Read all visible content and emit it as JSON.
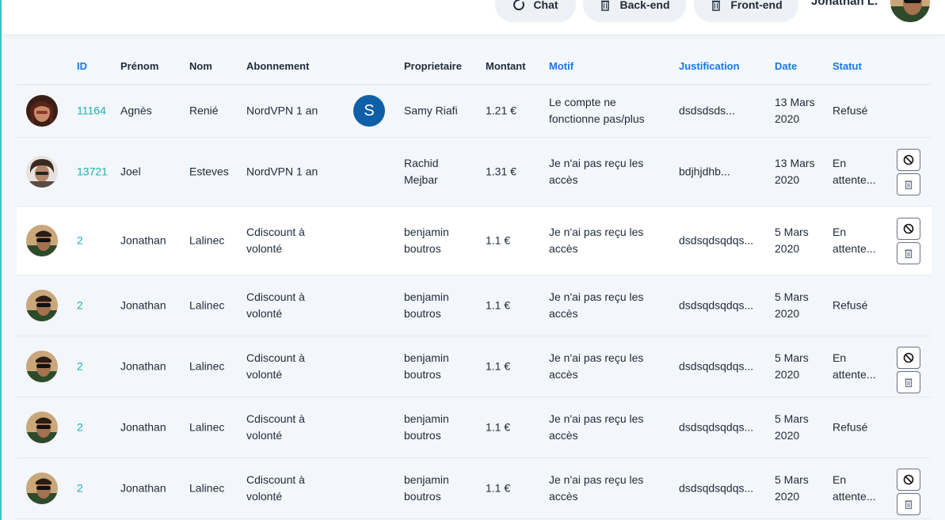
{
  "topbar": {
    "chat_label": "Chat",
    "backend_label": "Back-end",
    "frontend_label": "Front-end",
    "user_name": "Jonathan L."
  },
  "table": {
    "headers": {
      "id": "ID",
      "prenom": "Prénom",
      "nom": "Nom",
      "abonnement": "Abonnement",
      "proprietaire": "Proprietaire",
      "montant": "Montant",
      "motif": "Motif",
      "justification": "Justification",
      "date": "Date",
      "statut": "Statut"
    },
    "rows": [
      {
        "id": "11164",
        "prenom": "Agnès",
        "nom": "Renié",
        "abonnement": "NordVPN 1 an",
        "badge": "S",
        "proprietaire": "Samy Riafi",
        "montant": "1.21 €",
        "motif": "Le compte ne fonctionne pas/plus",
        "justification": "dsdsdsds...",
        "date": "13 Mars 2020",
        "statut": "Refusé"
      },
      {
        "id": "13721",
        "prenom": "Joel",
        "nom": "Esteves",
        "abonnement": "NordVPN 1 an",
        "proprietaire": "Rachid Mejbar",
        "montant": "1.31 €",
        "motif": "Je n'ai pas reçu les accès",
        "justification": "bdjhjdhb...",
        "date": "13 Mars 2020",
        "statut": "En attente..."
      },
      {
        "id": "2",
        "prenom": "Jonathan",
        "nom": "Lalinec",
        "abonnement": "Cdiscount à volonté",
        "proprietaire": "benjamin boutros",
        "montant": "1.1 €",
        "motif": "Je n'ai pas reçu les accès",
        "justification": "dsdsqdsqdqs...",
        "date": "5 Mars 2020",
        "statut": "En attente..."
      },
      {
        "id": "2",
        "prenom": "Jonathan",
        "nom": "Lalinec",
        "abonnement": "Cdiscount à volonté",
        "proprietaire": "benjamin boutros",
        "montant": "1.1 €",
        "motif": "Je n'ai pas reçu les accès",
        "justification": "dsdsqdsqdqs...",
        "date": "5 Mars 2020",
        "statut": "Refusé"
      },
      {
        "id": "2",
        "prenom": "Jonathan",
        "nom": "Lalinec",
        "abonnement": "Cdiscount à volonté",
        "proprietaire": "benjamin boutros",
        "montant": "1.1 €",
        "motif": "Je n'ai pas reçu les accès",
        "justification": "dsdsqdsqdqs...",
        "date": "5 Mars 2020",
        "statut": "En attente..."
      },
      {
        "id": "2",
        "prenom": "Jonathan",
        "nom": "Lalinec",
        "abonnement": "Cdiscount à volonté",
        "proprietaire": "benjamin boutros",
        "montant": "1.1 €",
        "motif": "Je n'ai pas reçu les accès",
        "justification": "dsdsqdsqdqs...",
        "date": "5 Mars 2020",
        "statut": "Refusé"
      },
      {
        "id": "2",
        "prenom": "Jonathan",
        "nom": "Lalinec",
        "abonnement": "Cdiscount à volonté",
        "proprietaire": "benjamin boutros",
        "montant": "1.1 €",
        "motif": "Je n'ai pas reçu les accès",
        "justification": "dsdsqdsqdqs...",
        "date": "5 Mars 2020",
        "statut": "En attente..."
      }
    ]
  },
  "colors": {
    "accent_blue": "#1877e6",
    "id_teal": "#1bb3b3",
    "badge_blue": "#0f5fa6"
  },
  "icons": {
    "chat": "chat-icon",
    "backend": "trash-icon",
    "frontend": "trash-icon",
    "block": "block-icon",
    "delete": "trash-icon"
  }
}
